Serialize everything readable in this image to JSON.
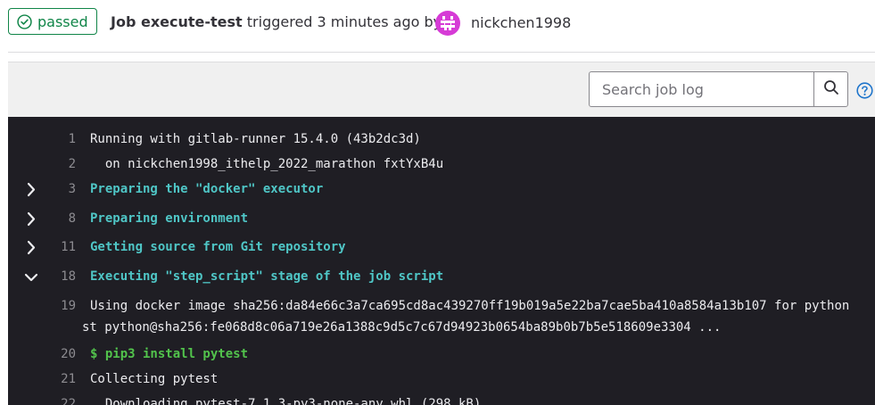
{
  "header": {
    "status_label": "passed",
    "job_prefix": "Job ",
    "job_name": "execute-test",
    "triggered_text": " triggered 3 minutes ago by",
    "username": "nickchen1998"
  },
  "toolbar": {
    "search_placeholder": "Search job log",
    "search_icon": "search-icon",
    "help_icon": "question-circle-icon"
  },
  "log": {
    "lines": [
      {
        "num": "1",
        "text": "Running with gitlab-runner 15.4.0 (43b2dc3d)"
      },
      {
        "num": "2",
        "text": "  on nickchen1998_ithelp_2022_marathon fxtYxB4u"
      },
      {
        "num": "3",
        "text": "Preparing the \"docker\" executor",
        "section": "collapsed"
      },
      {
        "num": "8",
        "text": "Preparing environment",
        "section": "collapsed"
      },
      {
        "num": "11",
        "text": "Getting source from Git repository",
        "section": "collapsed"
      },
      {
        "num": "18",
        "text": "Executing \"step_script\" stage of the job script",
        "section": "expanded"
      },
      {
        "num": "19",
        "text": "Using docker image sha256:da84e66c3a7ca695cd8ac439270ff19b019a5e22ba7cae5ba410a8584a13b107 for python"
      },
      {
        "num": "",
        "text": "st python@sha256:fe068d8c06a719e26a1388c9d5c7c67d94923b0654ba89b0b7b5e518609e3304 ..."
      },
      {
        "num": "20",
        "text": "$ pip3 install pytest",
        "command": true
      },
      {
        "num": "21",
        "text": "Collecting pytest"
      },
      {
        "num": "22",
        "text": "  Downloading pytest-7.1.3-py3-none-any.whl (298 kB)"
      }
    ]
  },
  "colors": {
    "success": "#108548",
    "log_bg": "#1f1e24",
    "section_text": "#4fc6c6",
    "command_text": "#52c34c",
    "avatar": "#d63bd6"
  }
}
